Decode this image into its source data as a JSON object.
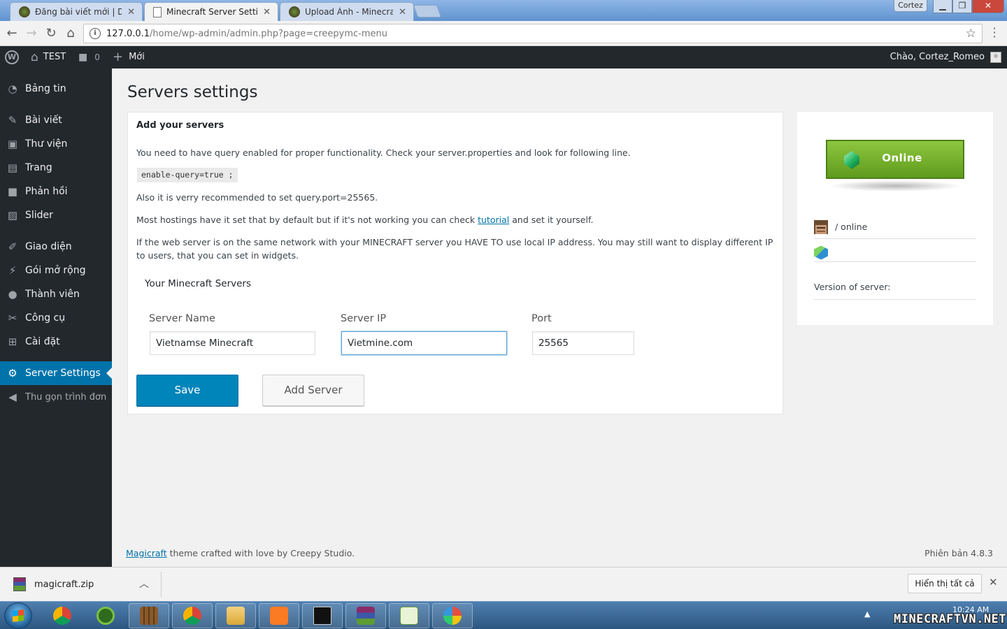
{
  "browser": {
    "tabs": [
      {
        "title": "Đăng bài viết mới | Diễn Đ"
      },
      {
        "title": "Minecraft Server Settings"
      },
      {
        "title": "Upload Ảnh - Minecraft V"
      }
    ],
    "profile_name": "Cortez",
    "url_host": "127.0.0.1",
    "url_path": "/home/wp-admin/admin.php?page=creepymc-menu"
  },
  "adminbar": {
    "site_name": "TEST",
    "comments_count": "0",
    "new_label": "Mới",
    "greeting": "Chào, Cortez_Romeo"
  },
  "sidebar": {
    "items": [
      {
        "label": "Bảng tin",
        "icon": "dashboard-icon"
      },
      {
        "label": "Bài viết",
        "icon": "pin-icon"
      },
      {
        "label": "Thư viện",
        "icon": "media-icon"
      },
      {
        "label": "Trang",
        "icon": "page-icon"
      },
      {
        "label": "Phản hồi",
        "icon": "comment-icon"
      },
      {
        "label": "Slider",
        "icon": "image-icon"
      },
      {
        "label": "Giao diện",
        "icon": "brush-icon"
      },
      {
        "label": "Gói mở rộng",
        "icon": "plugin-icon"
      },
      {
        "label": "Thành viên",
        "icon": "user-icon"
      },
      {
        "label": "Công cụ",
        "icon": "wrench-icon"
      },
      {
        "label": "Cài đặt",
        "icon": "settings-icon"
      },
      {
        "label": "Server Settings",
        "icon": "gear-icon"
      }
    ],
    "collapse_label": "Thu gọn trình đơn"
  },
  "page": {
    "title": "Servers settings",
    "box_title": "Add your servers",
    "intro": "You need to have query enabled for proper functionality. Check your server.properties and look for following line.",
    "code_line": "enable-query=true ;",
    "port_note": "Also it is verry recommended to set query.port=25565.",
    "hosting_note_before": "Most hostings have it set that by default but if it's not working you can check",
    "hosting_link": "tutorial",
    "hosting_note_after": "and set it yourself.",
    "network_note": "If the web server is on the same network with your MINECRAFT server you HAVE TO use local IP address. You may still want to display different IP to users, that you can set in widgets.",
    "servers_heading": "Your Minecraft Servers",
    "fields": {
      "name_label": "Server Name",
      "name_value": "Vietnamse Minecraft",
      "ip_label": "Server IP",
      "ip_value": "Vietmine.com",
      "port_label": "Port",
      "port_value": "25565"
    },
    "save_label": "Save",
    "add_server_label": "Add Server"
  },
  "widget": {
    "status": "Online",
    "players_text": "/ online",
    "version_label": "Version of server:"
  },
  "footer": {
    "theme_link": "Magicraft",
    "credit_text": "theme crafted with love by Creepy Studio.",
    "version_text": "Phiên bản 4.8.3"
  },
  "download_bar": {
    "file_name": "magicraft.zip",
    "show_all_label": "Hiển thị tất cả"
  },
  "taskbar": {
    "clock_time": "10:24 AM",
    "watermark": "MINECRAFTVN.NET"
  },
  "colors": {
    "wp_blue": "#0073aa",
    "admin_dark": "#23282d",
    "online_green": "#6aa827"
  }
}
